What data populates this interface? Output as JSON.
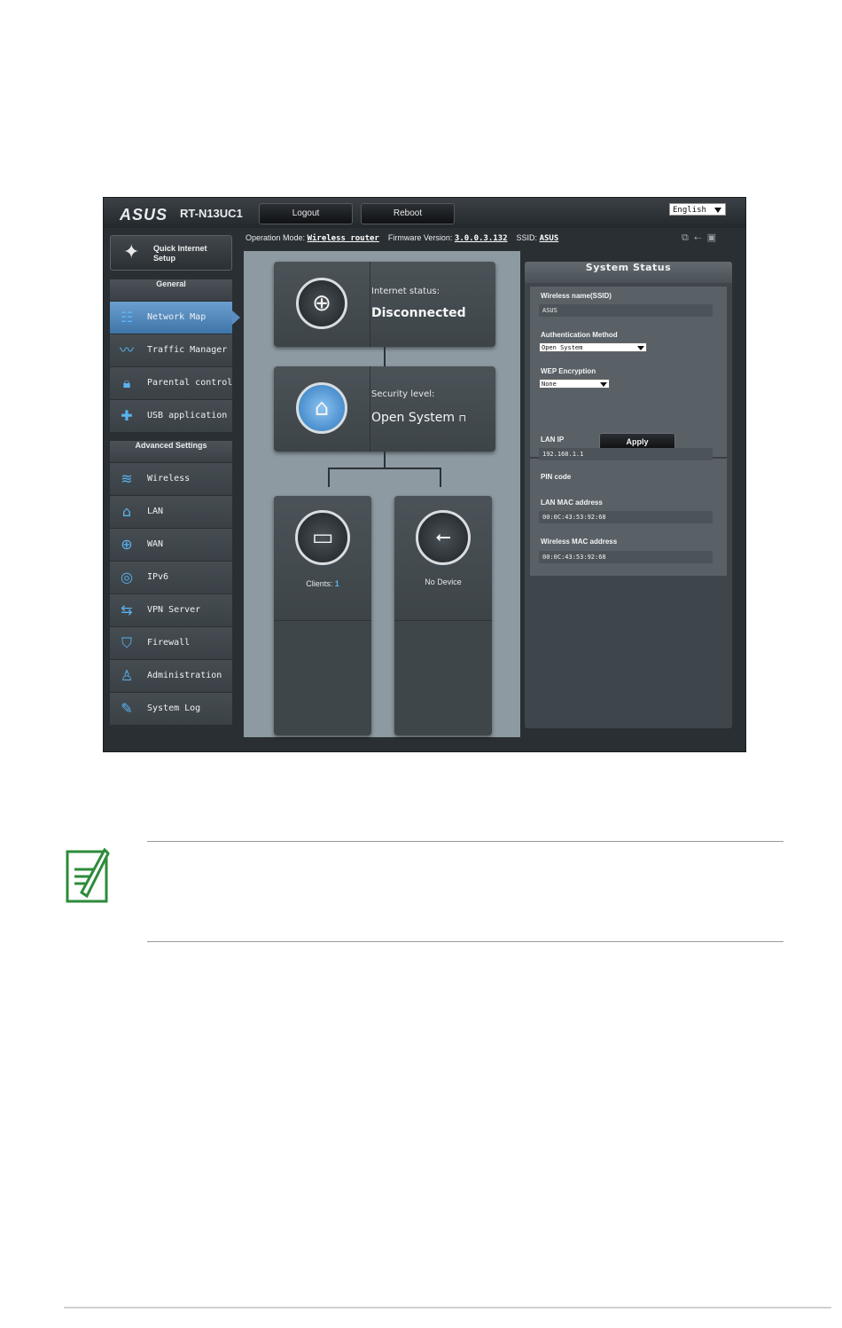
{
  "header": {
    "logo": "ASUS",
    "model": "RT-N13UC1",
    "logout_label": "Logout",
    "reboot_label": "Reboot",
    "language": "English"
  },
  "infobar": {
    "operation_mode_label": "Operation Mode:",
    "operation_mode_value": "Wireless router",
    "firmware_label": "Firmware Version:",
    "firmware_value": "3.0.0.3.132",
    "ssid_label": "SSID:",
    "ssid_value": "ASUS"
  },
  "quick_setup": {
    "label_line1": "Quick Internet",
    "label_line2": "Setup"
  },
  "menu": {
    "general_header": "General",
    "general_items": [
      {
        "label": "Network Map",
        "icon": "network-map-icon"
      },
      {
        "label": "Traffic Manager",
        "icon": "traffic-icon"
      },
      {
        "label": "Parental control",
        "icon": "lock-icon"
      },
      {
        "label": "USB application",
        "icon": "puzzle-icon"
      }
    ],
    "advanced_header": "Advanced Settings",
    "advanced_items": [
      {
        "label": "Wireless",
        "icon": "wifi-icon"
      },
      {
        "label": "LAN",
        "icon": "home-icon"
      },
      {
        "label": "WAN",
        "icon": "globe-icon"
      },
      {
        "label": "IPv6",
        "icon": "ipv6-icon"
      },
      {
        "label": "VPN Server",
        "icon": "vpn-icon"
      },
      {
        "label": "Firewall",
        "icon": "shield-icon"
      },
      {
        "label": "Administration",
        "icon": "user-icon"
      },
      {
        "label": "System Log",
        "icon": "log-icon"
      }
    ]
  },
  "map": {
    "internet_label": "Internet status:",
    "internet_value": "Disconnected",
    "security_label": "Security level:",
    "security_value": "Open System",
    "clients_label": "Clients:",
    "clients_count": "1",
    "usb_status": "No Device"
  },
  "system_status": {
    "title": "System Status",
    "ssid_label": "Wireless name(SSID)",
    "ssid_value": "ASUS",
    "auth_label": "Authentication Method",
    "auth_value": "Open System",
    "wep_label": "WEP Encryption",
    "wep_value": "None",
    "apply_label": "Apply",
    "lan_ip_label": "LAN IP",
    "lan_ip_value": "192.168.1.1",
    "pin_label": "PIN code",
    "lan_mac_label": "LAN MAC address",
    "lan_mac_value": "00:0C:43:53:92:68",
    "wl_mac_label": "Wireless MAC address",
    "wl_mac_value": "00:0C:43:53:92:68"
  },
  "colors": {
    "accent_blue": "#5ab3f0",
    "active_menu": "#4f86bd",
    "note_green": "#2e8b3a"
  }
}
